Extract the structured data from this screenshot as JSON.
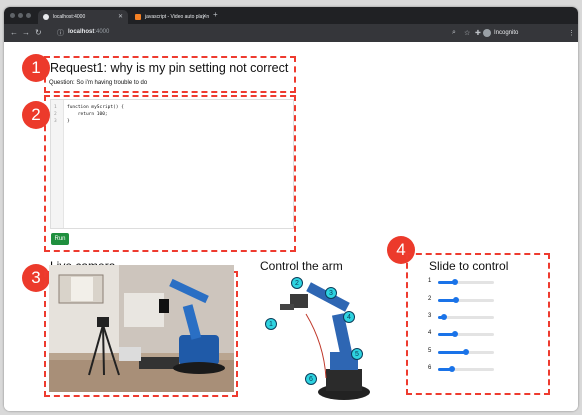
{
  "browser": {
    "tabs": [
      {
        "label": "localhost:4000",
        "active": true
      },
      {
        "label": "javascript - Video auto play n",
        "active": false
      }
    ],
    "url_host": "localhost",
    "url_port": ":4000",
    "profile_label": "Incognito"
  },
  "callouts": [
    "1",
    "2",
    "3",
    "4"
  ],
  "request": {
    "title": "Request1: why is my pin setting not correct",
    "question": "Question: So i'm having trouble to do"
  },
  "editor": {
    "line_numbers": [
      "1",
      "2",
      "3"
    ],
    "lines": [
      "function myScript() {",
      "    return 100;",
      "}"
    ],
    "run_label": "Run"
  },
  "camera": {
    "title": "Live camera"
  },
  "arm": {
    "title": "Control the arm",
    "joints": [
      "1",
      "2",
      "3",
      "4",
      "5",
      "6"
    ]
  },
  "sliders": {
    "title": "Slide to control",
    "items": [
      {
        "label": "1",
        "value": 0.3
      },
      {
        "label": "2",
        "value": 0.32
      },
      {
        "label": "3",
        "value": 0.1
      },
      {
        "label": "4",
        "value": 0.3
      },
      {
        "label": "5",
        "value": 0.5
      },
      {
        "label": "6",
        "value": 0.25
      }
    ]
  },
  "colors": {
    "callout": "#ec3a2b",
    "accent": "#1a73e8",
    "run": "#1f8f3e"
  }
}
